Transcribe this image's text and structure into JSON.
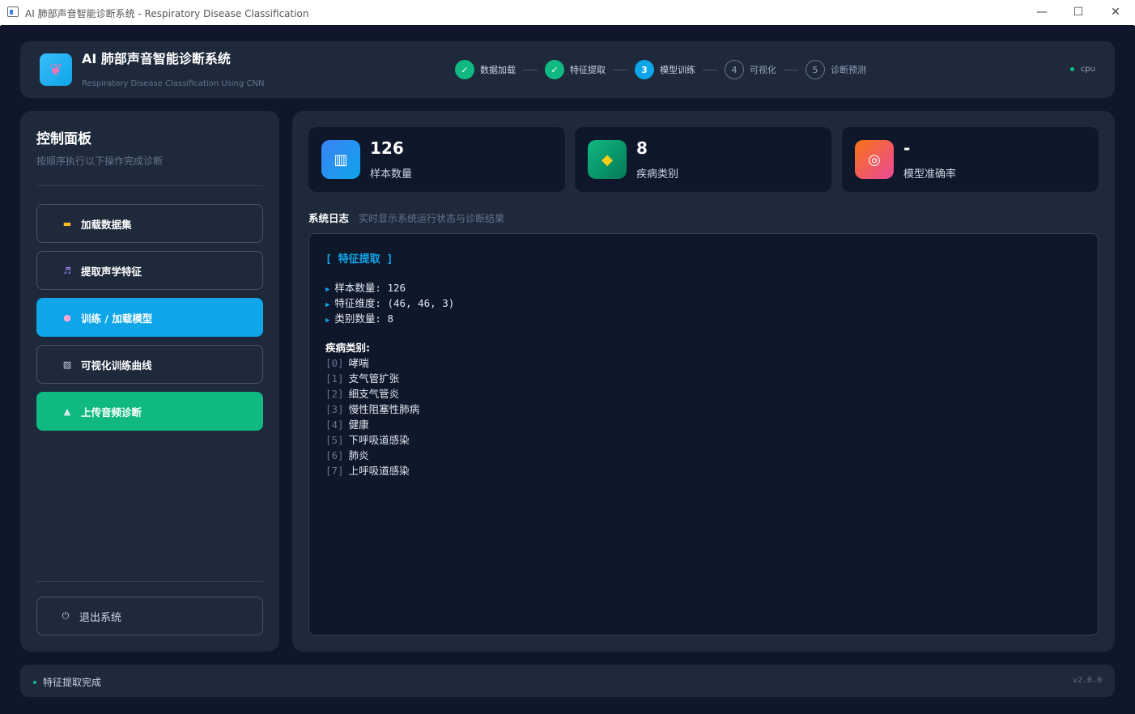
{
  "window": {
    "title": "AI 肺部声音智能诊断系统 - Respiratory Disease Classification",
    "minimize": "—",
    "maximize": "☐",
    "close": "✕"
  },
  "header": {
    "title": "AI 肺部声音智能诊断系统",
    "subtitle": "Respiratory Disease Classification Using CNN",
    "logo_icon": "lungs-icon",
    "device": "cpu",
    "steps": [
      {
        "marker": "✓",
        "label": "数据加载",
        "state": "done"
      },
      {
        "marker": "✓",
        "label": "特征提取",
        "state": "done"
      },
      {
        "marker": "3",
        "label": "模型训练",
        "state": "active"
      },
      {
        "marker": "4",
        "label": "可视化",
        "state": "pending"
      },
      {
        "marker": "5",
        "label": "诊断预测",
        "state": "pending"
      }
    ]
  },
  "sidebar": {
    "title": "控制面板",
    "subtitle": "按顺序执行以下操作完成诊断",
    "buttons": [
      {
        "label": "加载数据集",
        "icon": "folder-icon",
        "glyph": "▬"
      },
      {
        "label": "提取声学特征",
        "icon": "music-note-icon",
        "glyph": "♬"
      },
      {
        "label": "训练 / 加载模型",
        "icon": "brain-icon",
        "glyph": "●"
      },
      {
        "label": "可视化训练曲线",
        "icon": "chart-icon",
        "glyph": "▧"
      },
      {
        "label": "上传音频诊断",
        "icon": "microscope-icon",
        "glyph": "▲"
      }
    ],
    "exit_label": "退出系统",
    "exit_glyph": "⏻"
  },
  "stats": [
    {
      "value": "126",
      "label": "样本数量",
      "icon": "bar-chart-icon",
      "glyph": "▥"
    },
    {
      "value": "8",
      "label": "疾病类别",
      "icon": "tag-icon",
      "glyph": "◆"
    },
    {
      "value": "-",
      "label": "模型准确率",
      "icon": "target-icon",
      "glyph": "◎"
    }
  ],
  "log": {
    "title": "系统日志",
    "subtitle": "实时显示系统运行状态与诊断结果",
    "section": "[ 特征提取 ]",
    "arrow": "▶",
    "lines": [
      "样本数量: 126",
      "特征维度: (46, 46, 3)",
      "类别数量: 8"
    ],
    "categories_title": "疾病类别:",
    "categories": [
      {
        "idx": "[0]",
        "name": "哮喘"
      },
      {
        "idx": "[1]",
        "name": "支气管扩张"
      },
      {
        "idx": "[2]",
        "name": "细支气管炎"
      },
      {
        "idx": "[3]",
        "name": "慢性阻塞性肺病"
      },
      {
        "idx": "[4]",
        "name": "健康"
      },
      {
        "idx": "[5]",
        "name": "下呼吸道感染"
      },
      {
        "idx": "[6]",
        "name": "肺炎"
      },
      {
        "idx": "[7]",
        "name": "上呼吸道感染"
      }
    ]
  },
  "status": {
    "text": "特征提取完成",
    "version": "v2.0.0"
  },
  "colors": {
    "accent": "#0ea5e9",
    "success": "#10b981",
    "background": "#0f172a",
    "panel": "#1e293b"
  }
}
